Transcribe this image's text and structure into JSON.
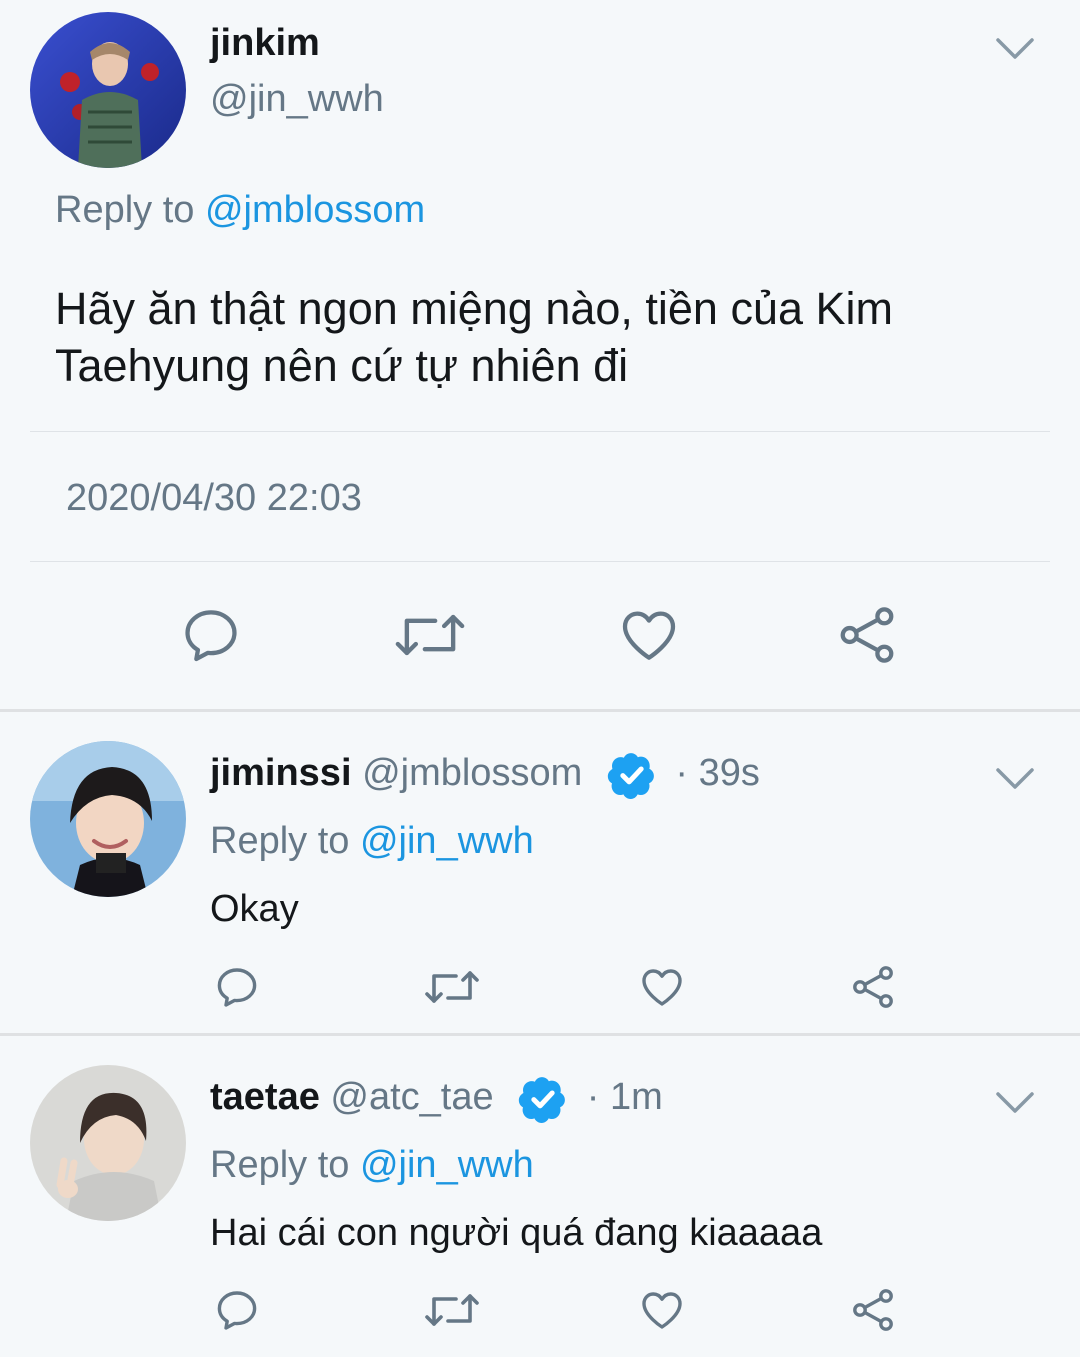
{
  "main_tweet": {
    "display_name": "jinkim",
    "handle": "@jin_wwh",
    "reply_prefix": "Reply to",
    "reply_to": "@jmblossom",
    "text_line1": "Hãy ăn thật ngon miệng nào, tiền của Kim",
    "text_line2": "Taehyung nên cứ tự nhiên đi",
    "timestamp": "2020/04/30 22:03"
  },
  "replies": [
    {
      "display_name": "jiminssi",
      "handle": "@jmblossom",
      "time": "· 39s",
      "verified": true,
      "reply_prefix": "Reply to",
      "reply_to": "@jin_wwh",
      "text": "Okay"
    },
    {
      "display_name": "taetae",
      "handle": "@atc_tae",
      "time": "· 1m",
      "verified": true,
      "reply_prefix": "Reply to",
      "reply_to": "@jin_wwh",
      "text": "Hai cái con người quá đang kiaaaaa"
    }
  ],
  "icons": {
    "reply": "reply-icon",
    "retweet": "retweet-icon",
    "like": "heart-icon",
    "share": "share-icon",
    "menu": "chevron-down-icon",
    "verified": "verified-badge-icon"
  },
  "colors": {
    "background": "#f5f8fa",
    "accent": "#1b95e0",
    "text": "#14171a",
    "muted": "#657786",
    "icon": "#657786",
    "verified": "#1da1f2"
  }
}
